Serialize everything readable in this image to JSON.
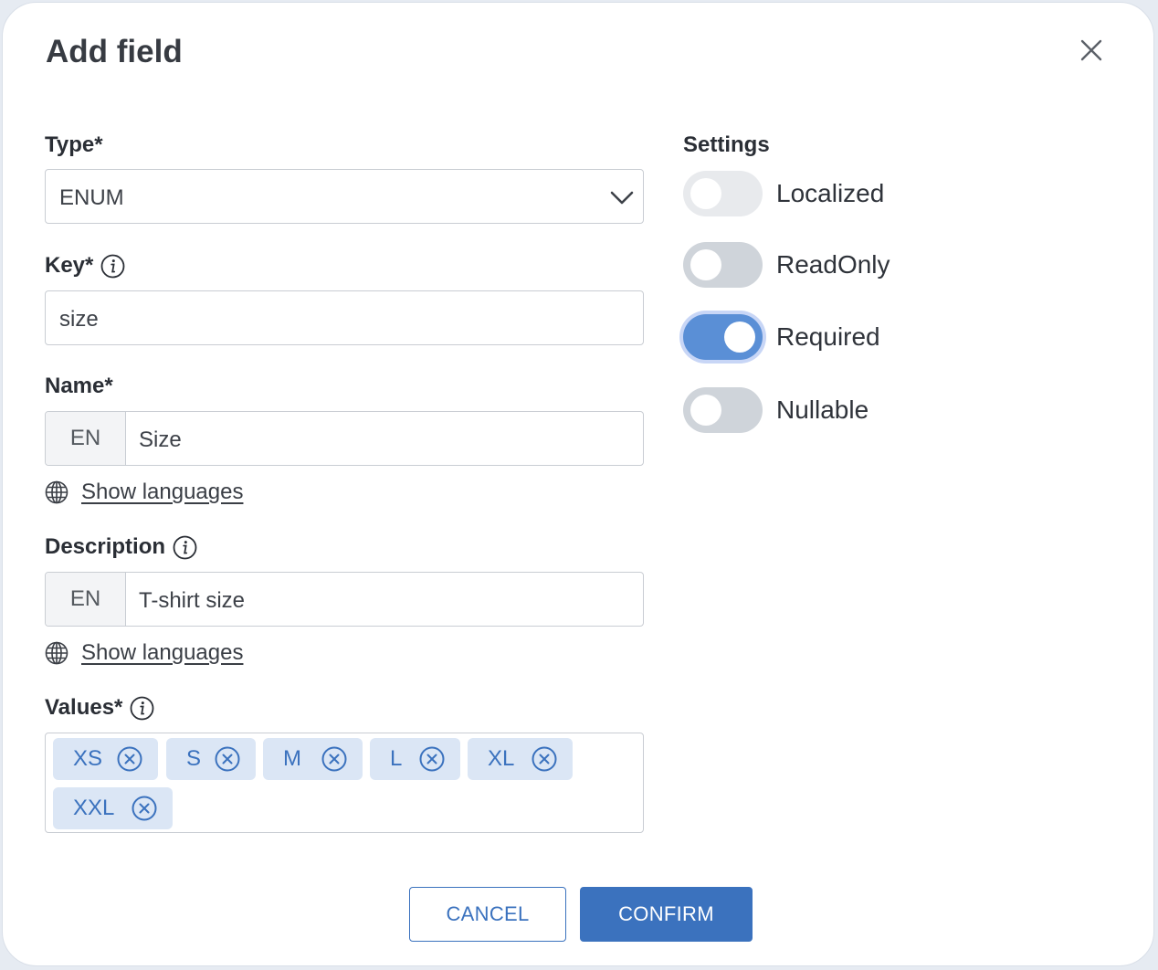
{
  "dialog": {
    "title": "Add field"
  },
  "type": {
    "label": "Type*",
    "value": "ENUM"
  },
  "key": {
    "label": "Key*",
    "value": "size"
  },
  "name": {
    "label": "Name*",
    "lang": "EN",
    "value": "Size",
    "show_languages": "Show languages"
  },
  "description": {
    "label": "Description",
    "lang": "EN",
    "value": "T-shirt size",
    "show_languages": "Show languages"
  },
  "values": {
    "label": "Values*",
    "items": [
      "XS",
      "S",
      "M",
      "L",
      "XL",
      "XXL"
    ]
  },
  "settings": {
    "title": "Settings",
    "toggles": [
      {
        "label": "Localized",
        "state": "off-disabled"
      },
      {
        "label": "ReadOnly",
        "state": "off"
      },
      {
        "label": "Required",
        "state": "on"
      },
      {
        "label": "Nullable",
        "state": "off"
      }
    ]
  },
  "buttons": {
    "cancel": "CANCEL",
    "confirm": "CONFIRM"
  },
  "colors": {
    "primary": "#3b72be",
    "toggle_on": "#5a8fd6",
    "chip_bg": "#dbe6f5"
  }
}
